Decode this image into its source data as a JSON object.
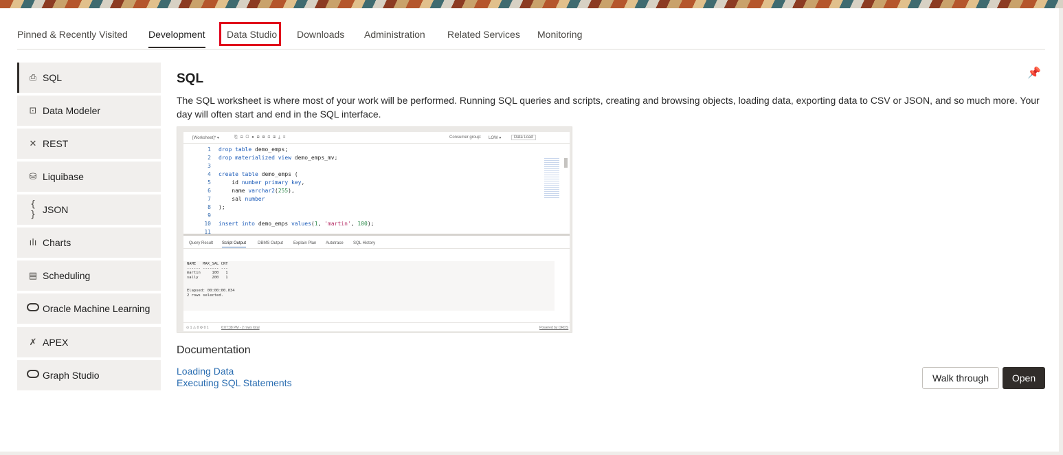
{
  "tabs": [
    {
      "label": "Pinned & Recently Visited"
    },
    {
      "label": "Development"
    },
    {
      "label": "Data Studio"
    },
    {
      "label": "Downloads"
    },
    {
      "label": "Administration"
    },
    {
      "label": "Related Services"
    },
    {
      "label": "Monitoring"
    }
  ],
  "active_tab": "Development",
  "highlighted_tab": "Data Studio",
  "sidebar": {
    "items": [
      {
        "label": "SQL",
        "icon": "sql-icon",
        "glyph": "⎙"
      },
      {
        "label": "Data Modeler",
        "icon": "data-modeler-icon",
        "glyph": "⊡"
      },
      {
        "label": "REST",
        "icon": "rest-icon",
        "glyph": "✕"
      },
      {
        "label": "Liquibase",
        "icon": "liquibase-icon",
        "glyph": "⛁"
      },
      {
        "label": "JSON",
        "icon": "json-icon",
        "glyph": "{ }"
      },
      {
        "label": "Charts",
        "icon": "charts-icon",
        "glyph": "ılı"
      },
      {
        "label": "Scheduling",
        "icon": "scheduling-icon",
        "glyph": "▤"
      },
      {
        "label": "Oracle Machine Learning",
        "icon": "oml-icon",
        "glyph": ""
      },
      {
        "label": "APEX",
        "icon": "apex-icon",
        "glyph": "✗"
      },
      {
        "label": "Graph Studio",
        "icon": "graph-studio-icon",
        "glyph": ""
      }
    ]
  },
  "main": {
    "title": "SQL",
    "description": "The SQL worksheet is where most of your work will be performed. Running SQL queries and scripts, creating and browsing objects, loading data, exporting data to CSV or JSON, and so much more. Your day will often start and end in the SQL interface.",
    "documentation_title": "Documentation",
    "links": [
      {
        "label": "Loading Data"
      },
      {
        "label": "Executing SQL Statements"
      }
    ],
    "walk_through_label": "Walk through",
    "open_label": "Open"
  },
  "preview": {
    "toolbar_left": "[Worksheet]* ▾",
    "consumer_group_label": "Consumer group:",
    "consumer_group_value": "LOW ▾",
    "data_load_label": "Data Load",
    "code_lines": [
      {
        "n": "1",
        "text": "drop table demo_emps;"
      },
      {
        "n": "2",
        "text": "drop materialized view demo_emps_mv;"
      },
      {
        "n": "3",
        "text": ""
      },
      {
        "n": "4",
        "text": "create table demo_emps ("
      },
      {
        "n": "5",
        "text": "    id number primary key,"
      },
      {
        "n": "6",
        "text": "    name varchar2(255),"
      },
      {
        "n": "7",
        "text": "    sal number"
      },
      {
        "n": "8",
        "text": ");"
      },
      {
        "n": "9",
        "text": ""
      },
      {
        "n": "10",
        "text": "insert into demo_emps values(1, 'martin', 100);"
      },
      {
        "n": "11",
        "text": ""
      }
    ],
    "output_tabs": [
      "Query Result",
      "Script Output",
      "DBMS Output",
      "Explain Plan",
      "Autotrace",
      "SQL History"
    ],
    "output_active": "Script Output",
    "output_text": "NAME   MAX_SAL CNT\n------ ------- ---\nmartin     100   1\nsally      200   1\n\n\nElapsed: 00:00:00.034\n2 rows selected.",
    "status_left": "⊙ 1 ⚠ 0 ⚙ 0 1",
    "status_time": "6:07:38 PM - 2 rows total",
    "status_right": "Powered by ORDS"
  }
}
